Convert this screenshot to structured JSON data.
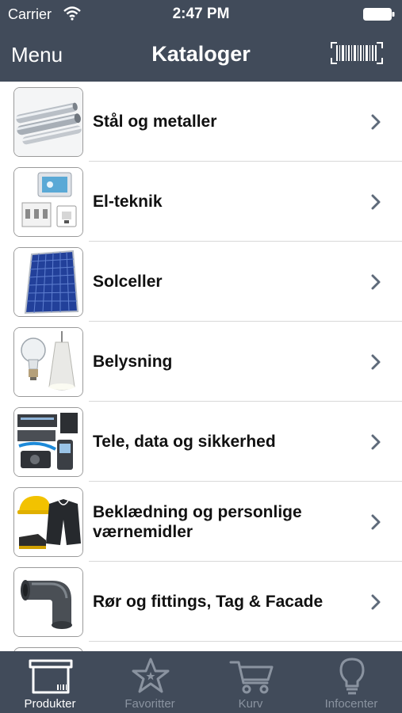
{
  "status_bar": {
    "carrier": "Carrier",
    "time": "2:47 PM",
    "icons": [
      "wifi-icon",
      "battery-icon"
    ]
  },
  "nav_bar": {
    "menu_label": "Menu",
    "title": "Kataloger",
    "scan_icon": "barcode-icon",
    "background_color": "#414b5a"
  },
  "catalogs": {
    "items": [
      {
        "label": "Stål og metaller",
        "icon": "steel-pipes-icon"
      },
      {
        "label": "El-teknik",
        "icon": "electrical-equipment-icon"
      },
      {
        "label": "Solceller",
        "icon": "solar-panel-icon"
      },
      {
        "label": "Belysning",
        "icon": "light-bulb-icon"
      },
      {
        "label": "Tele, data og sikkerhed",
        "icon": "network-equipment-icon"
      },
      {
        "label": "Beklædning og personlige værnemidler",
        "icon": "protective-gear-icon"
      },
      {
        "label": "Rør og fittings, Tag & Facade",
        "icon": "pipe-fitting-icon"
      }
    ]
  },
  "tab_bar": {
    "tabs": [
      {
        "label": "Produkter",
        "icon": "box-icon",
        "active": true
      },
      {
        "label": "Favoritter",
        "icon": "star-icon",
        "active": false
      },
      {
        "label": "Kurv",
        "icon": "cart-icon",
        "active": false
      },
      {
        "label": "Infocenter",
        "icon": "lightbulb-icon",
        "active": false
      }
    ],
    "active_color": "#ffffff",
    "inactive_color": "#8a93a0"
  }
}
